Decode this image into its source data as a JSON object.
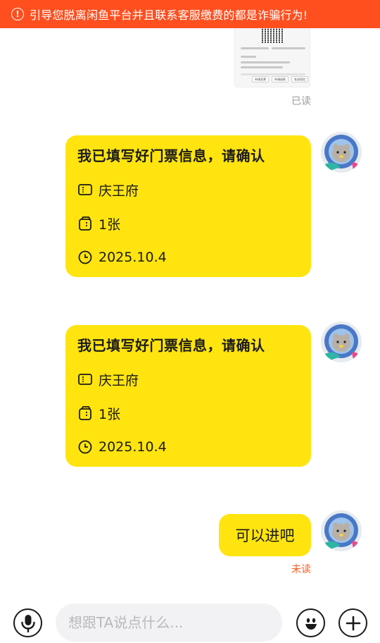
{
  "banner": {
    "icon": "exclamation-circle-icon",
    "text": "引导您脱离闲鱼平台并且联系客服缴费的都是诈骗行为!",
    "color": "#ff4f1f"
  },
  "top_message": {
    "type": "image-screenshot",
    "buttons": [
      "申请发票",
      "申请退款",
      "发送短信"
    ],
    "read_status": "已读"
  },
  "ticket_cards": [
    {
      "title": "我已填写好门票信息，请确认",
      "place": "庆王府",
      "quantity": "1张",
      "date": "2025.10.4"
    },
    {
      "title": "我已填写好门票信息，请确认",
      "place": "庆王府",
      "quantity": "1张",
      "date": "2025.10.4"
    }
  ],
  "last_message": {
    "text": "可以进吧",
    "read_status": "未读"
  },
  "input_bar": {
    "placeholder": "想跟TA说点什么...",
    "value": ""
  },
  "colors": {
    "bubble": "#ffe40f",
    "unread": "#ff5a1f",
    "read": "#9b9b9b"
  }
}
